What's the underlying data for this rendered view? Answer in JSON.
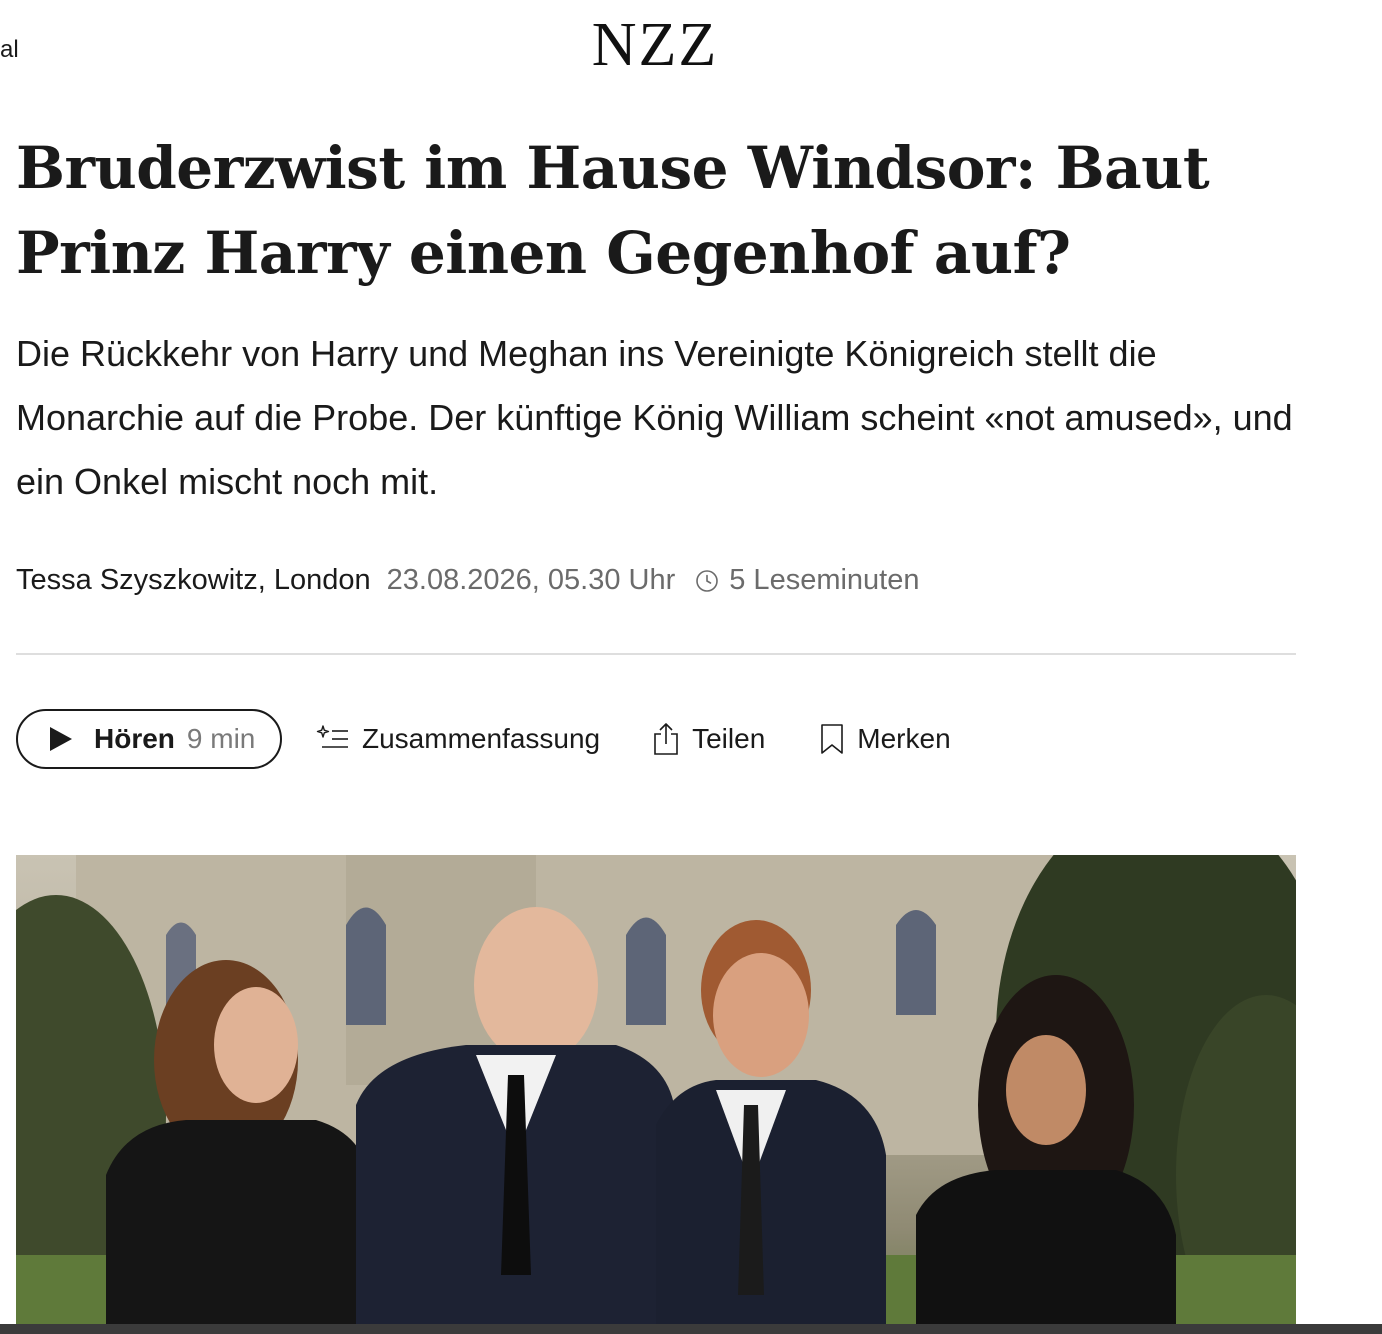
{
  "nav": {
    "partial_label": "al"
  },
  "brand": {
    "logo": "NZZ"
  },
  "article": {
    "headline": "Bruderzwist im Hause Windsor: Baut Prinz Harry einen Gegenhof auf?",
    "lead": "Die Rückkehr von Harry und Meghan ins Vereinigte Königreich stellt die Monarchie auf die Probe. Der künftige König William scheint «not amused», und ein Onkel mischt noch mit.",
    "byline": "Tessa Szyszkowitz, London",
    "date": "23.08.2026, 05.30 Uhr",
    "reading_time": "5 Leseminuten"
  },
  "actions": {
    "listen_label": "Hören",
    "listen_duration": "9 min",
    "summary_label": "Zusammenfassung",
    "share_label": "Teilen",
    "bookmark_label": "Merken"
  },
  "hero": {
    "alt": "Vier Personen in dunkler Kleidung vor einem Schloss"
  },
  "colors": {
    "text": "#1a1a1a",
    "muted": "#6b6b6b",
    "divider": "#dedede"
  },
  "icons": [
    "play-icon",
    "sparkle-list-icon",
    "share-icon",
    "bookmark-icon",
    "clock-icon"
  ]
}
